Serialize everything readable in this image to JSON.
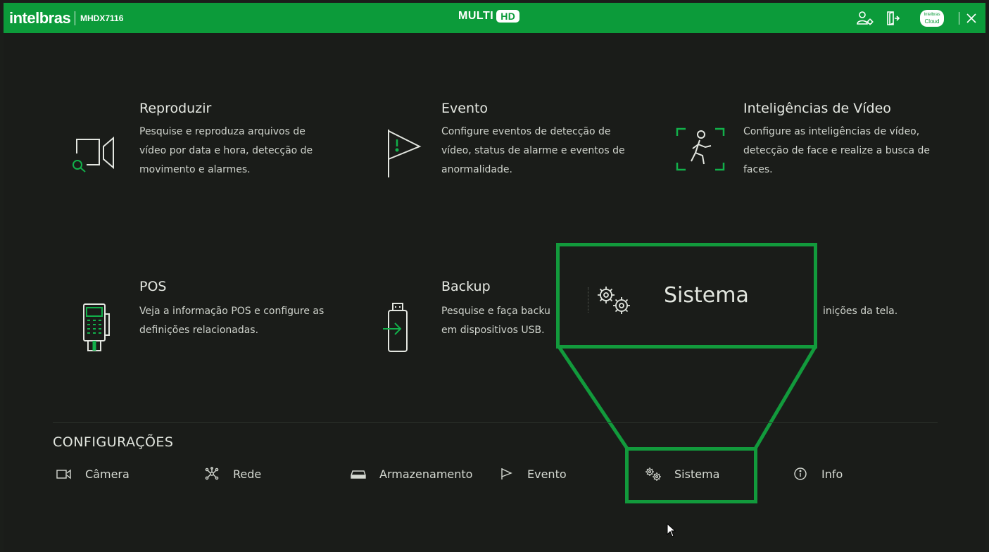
{
  "topbar": {
    "brand": "intelbras",
    "model": "MHDX7116",
    "product_left": "MULTI",
    "product_badge": "HD",
    "cloud_line1": "Intelbras",
    "cloud_line2": "Cloud",
    "icons": [
      "user-settings-icon",
      "logout-icon",
      "intelbras-cloud-icon",
      "close-icon"
    ]
  },
  "cards": {
    "reproduzir": {
      "title": "Reproduzir",
      "desc": "Pesquise e reproduza arquivos de\nvídeo por data e hora, detecção de\nmovimento e alarmes.",
      "icon": "playback-search-icon"
    },
    "evento": {
      "title": "Evento",
      "desc": "Configure eventos de detecção de\nvídeo, status de alarme e eventos de\nanormalidade.",
      "icon": "event-flag-icon"
    },
    "inteligencias": {
      "title": "Inteligências de Vídeo",
      "desc": "Configure as inteligências de vídeo,\ndetecção de face e realize a busca de\nfaces.",
      "icon": "person-detection-icon"
    },
    "pos": {
      "title": "POS",
      "desc": "Veja a informação POS e configure as\ndefinições relacionadas.",
      "icon": "pos-terminal-icon"
    },
    "backup": {
      "title": "Backup",
      "desc": "Pesquise e faça backu\nem dispositivos USB.",
      "icon": "usb-backup-icon"
    },
    "display_partial": {
      "desc": "inições da tela."
    }
  },
  "zoom_callout": {
    "label": "Sistema",
    "icon": "gears-icon"
  },
  "configuracoes": {
    "title": "CONFIGURAÇÕES",
    "items": [
      {
        "label": "Câmera",
        "icon": "camera-icon"
      },
      {
        "label": "Rede",
        "icon": "network-icon"
      },
      {
        "label": "Armazenamento",
        "icon": "storage-icon"
      },
      {
        "label": "Evento",
        "icon": "event-flag-icon"
      },
      {
        "label": "Sistema",
        "icon": "gears-icon"
      },
      {
        "label": "Info",
        "icon": "info-icon"
      }
    ]
  },
  "colors": {
    "brand_green": "#0c9b3a",
    "highlight_green": "#129a3c",
    "background": "#1a1c19",
    "text": "#d9ddd6"
  }
}
